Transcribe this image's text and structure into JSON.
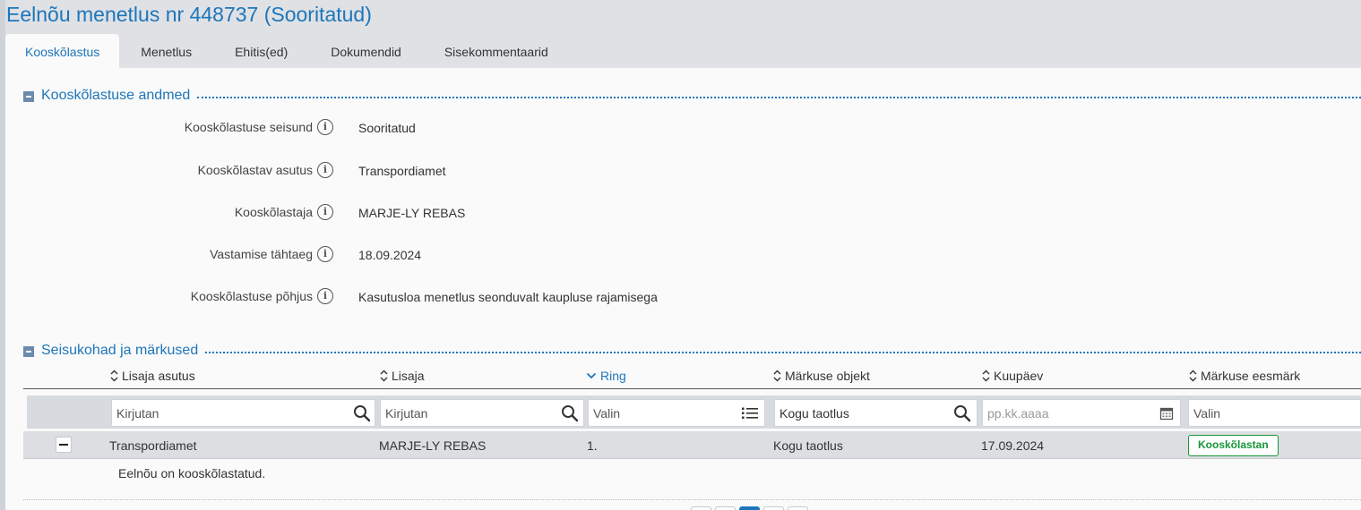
{
  "header": {
    "title": "Eelnõu menetlus nr 448737 (Sooritatud)",
    "tabs": [
      {
        "label": "Kooskõlastus",
        "active": true
      },
      {
        "label": "Menetlus"
      },
      {
        "label": "Ehitis(ed)"
      },
      {
        "label": "Dokumendid"
      },
      {
        "label": "Sisekommentaarid"
      }
    ]
  },
  "approval_details": {
    "title": "Kooskõlastuse andmed",
    "fields": [
      {
        "label": "Kooskõlastuse seisund",
        "value": "Sooritatud"
      },
      {
        "label": "Kooskõlastav asutus",
        "value": "Transpordiamet"
      },
      {
        "label": "Kooskõlastaja",
        "value": "MARJE-LY REBAS"
      },
      {
        "label": "Vastamise tähtaeg",
        "value": "18.09.2024"
      },
      {
        "label": "Kooskõlastuse põhjus",
        "value": "Kasutusloa menetlus seonduvalt kaupluse rajamisega"
      }
    ],
    "info_icon": "info-circle-icon"
  },
  "remarks": {
    "title": "Seisukohad ja märkused",
    "columns": [
      "Lisaja asutus",
      "Lisaja",
      "Ring",
      "Märkuse objekt",
      "Kuupäev",
      "Märkuse eesmärk"
    ],
    "sorted_column": "Ring",
    "filters": {
      "lisaja_asutus": "Kirjutan",
      "lisaja": "Kirjutan",
      "ring": "Valin",
      "markuse_objekt_value": "Kogu taotlus",
      "kuupaev": "pp.kk.aaaa",
      "markuse_eesmark": "Valin"
    },
    "rows": [
      {
        "lisaja_asutus": "Transpordiamet",
        "lisaja": "MARJE-LY REBAS",
        "ring": "1.",
        "markuse_objekt": "Kogu taotlus",
        "kuupaev": "17.09.2024",
        "markuse_eesmark": "Kooskõlastan",
        "comment": "Eelnõu on kooskõlastatud."
      }
    ]
  },
  "colors": {
    "accent": "#1e76ba",
    "approve_green": "#17963a",
    "header_bg": "#dfe1e5"
  }
}
